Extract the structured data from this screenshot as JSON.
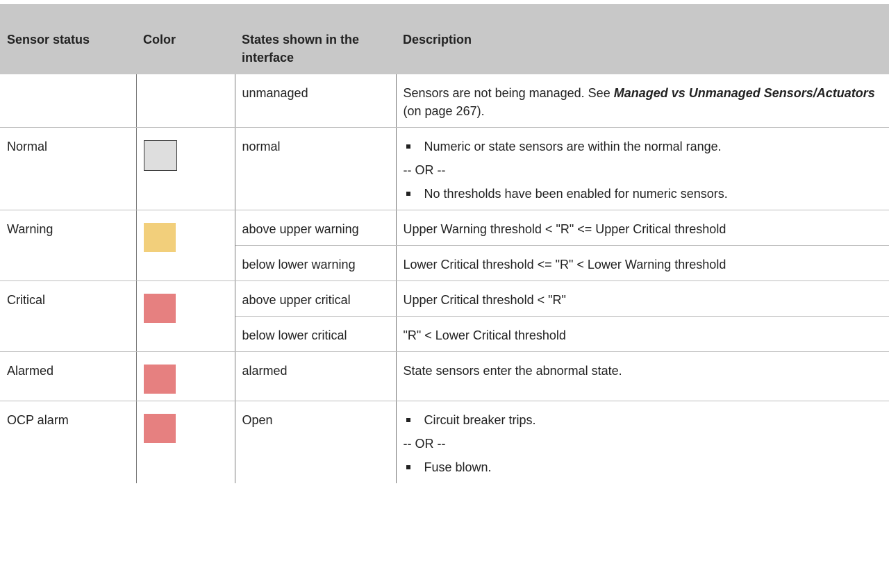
{
  "headers": {
    "status": "Sensor status",
    "color": "Color",
    "states": "States shown in the interface",
    "description": "Description"
  },
  "rows": {
    "unmanaged": {
      "state": "unmanaged",
      "desc_prefix": "Sensors are not being managed. See ",
      "desc_link": "Managed vs Unmanaged Sensors/Actuators",
      "desc_suffix": " (on page 267)."
    },
    "normal": {
      "status": "Normal",
      "state": "normal",
      "bullet1": "Numeric or state sensors are within the normal range.",
      "or": "-- OR --",
      "bullet2": "No thresholds have been enabled for numeric sensors."
    },
    "warning": {
      "status": "Warning",
      "state1": "above upper warning",
      "desc1": "Upper Warning threshold < \"R\" <= Upper Critical threshold",
      "state2": "below lower warning",
      "desc2": "Lower Critical threshold <= \"R\" < Lower Warning threshold"
    },
    "critical": {
      "status": "Critical",
      "state1": "above upper critical",
      "desc1": "Upper Critical threshold < \"R\"",
      "state2": "below lower critical",
      "desc2": "\"R\" < Lower Critical threshold"
    },
    "alarmed": {
      "status": "Alarmed",
      "state": "alarmed",
      "desc": "State sensors enter the abnormal state."
    },
    "ocp": {
      "status": "OCP alarm",
      "state": "Open",
      "bullet1": "Circuit breaker trips.",
      "or": "-- OR --",
      "bullet2": "Fuse blown."
    }
  },
  "colors": {
    "normal": "#dedede",
    "warning": "#f2cf7b",
    "critical": "#e68080",
    "header_bg": "#c8c8c8"
  }
}
